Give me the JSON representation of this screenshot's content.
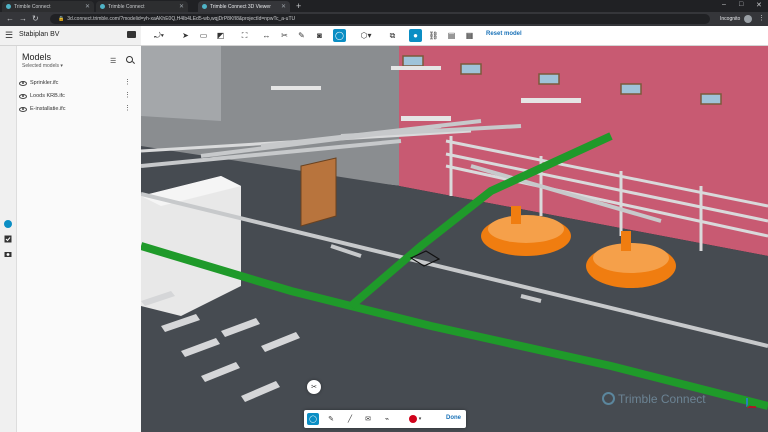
{
  "browser": {
    "tabs": [
      {
        "label": "Trimble Connect",
        "active": false
      },
      {
        "label": "Trimble Connect",
        "active": false
      },
      {
        "label": "Trimble Connect 3D Viewer",
        "active": true
      }
    ],
    "new_tab": "+",
    "url": "3d.connect.trimble.com/?modelid=yh-xaAKhE0Q,H4Ib4LEd5-wb,wqjDrP8KfI8&projectId=npwTc_a-uTU",
    "incognito_label": "Incognito"
  },
  "app": {
    "project_name": "Stabiplan BV",
    "reset_label": "Reset model"
  },
  "sidebar": {
    "title": "Models",
    "subtitle": "Selected models",
    "models": [
      {
        "name": "Sprinkler.ifc"
      },
      {
        "name": "Loods KRB.ifc"
      },
      {
        "name": "E-installatie.ifc"
      }
    ]
  },
  "markup_bar": {
    "done_label": "Done",
    "color": "#d0021b"
  },
  "watermark": "Trimble Connect",
  "colors": {
    "accent": "#0b8ec4",
    "pipe_green": "#1f9a2a",
    "wall_red": "#c85a72",
    "tank_orange": "#f07d10"
  }
}
